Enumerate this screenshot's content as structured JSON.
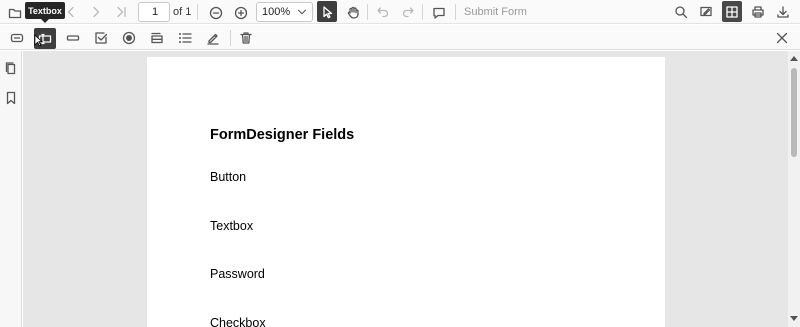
{
  "toolbar": {
    "current_page": "1",
    "page_total": "of 1",
    "zoom": "100%",
    "submit_label": "Submit Form"
  },
  "tooltip": "Textbox",
  "document": {
    "heading": "FormDesigner Fields",
    "fields": [
      "Button",
      "Textbox",
      "Password",
      "Checkbox"
    ]
  },
  "icons": {
    "main": [
      "open-file-icon",
      "previous-page-icon",
      "next-page-icon",
      "last-page-icon",
      "zoom-out-icon",
      "zoom-in-icon",
      "chevron-down-icon",
      "text-select-icon",
      "pan-icon",
      "undo-icon",
      "redo-icon",
      "comment-icon",
      "search-icon",
      "annotation-icon",
      "form-designer-icon",
      "print-icon",
      "download-icon"
    ],
    "form": [
      "button-field-icon",
      "textbox-field-icon",
      "password-field-icon",
      "checkbox-field-icon",
      "radio-button-icon",
      "dropdown-field-icon",
      "listbox-field-icon",
      "signature-field-icon",
      "delete-icon",
      "close-icon"
    ],
    "side": [
      "page-thumbnails-icon",
      "bookmark-icon"
    ]
  },
  "colors": {
    "active_tool": "#3e3e3e",
    "viewer_background": "#e6e6e6",
    "tooltip": "#262626"
  }
}
